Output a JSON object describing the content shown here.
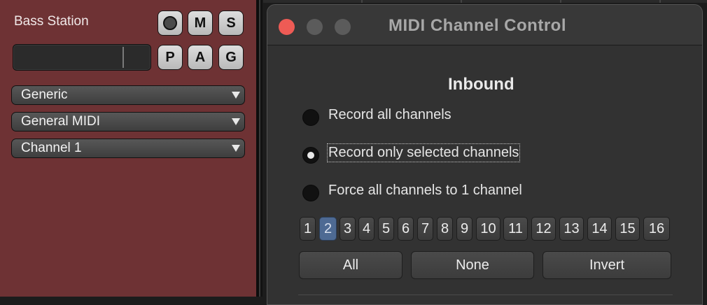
{
  "track": {
    "name": "Bass Station",
    "buttons_row1": [
      "M",
      "S"
    ],
    "buttons_row2": [
      "P",
      "A",
      "G"
    ],
    "dropdowns": [
      "Generic",
      "General MIDI",
      "Channel  1"
    ]
  },
  "window": {
    "title": "MIDI Channel Control",
    "section_title": "Inbound",
    "radio_options": [
      {
        "label": "Record all channels",
        "selected": false
      },
      {
        "label": "Record only selected channels",
        "selected": true
      },
      {
        "label": "Force all channels to 1 channel",
        "selected": false
      }
    ],
    "channels": [
      "1",
      "2",
      "3",
      "4",
      "5",
      "6",
      "7",
      "8",
      "9",
      "10",
      "11",
      "12",
      "13",
      "14",
      "15",
      "16"
    ],
    "selected_channels": [
      "2"
    ],
    "actions": [
      "All",
      "None",
      "Invert"
    ]
  },
  "colors": {
    "track_bg": "#6e3234",
    "window_bg": "#323232",
    "selected_channel": "#4e6a93",
    "close_light": "#ee5b55"
  }
}
